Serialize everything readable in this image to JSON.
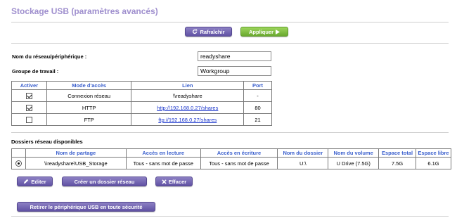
{
  "page": {
    "title": "Stockage USB (paramètres avancés)"
  },
  "toolbar": {
    "refresh_label": "Rafraîchir",
    "apply_label": "Appliquer"
  },
  "form": {
    "device_name_label": "Nom du réseau/périphérique :",
    "device_name_value": "readyshare",
    "workgroup_label": "Groupe de travail :",
    "workgroup_value": "Workgroup"
  },
  "access_table": {
    "headers": [
      "Activer",
      "Mode d'accès",
      "Lien",
      "Port"
    ],
    "rows": [
      {
        "enabled": true,
        "mode": "Connexion réseau",
        "link": "\\\\readyshare",
        "link_is_url": false,
        "port": "-"
      },
      {
        "enabled": true,
        "mode": "HTTP",
        "link": "http://192.168.0.27/shares",
        "link_is_url": true,
        "port": "80"
      },
      {
        "enabled": false,
        "mode": "FTP",
        "link": "ftp://192.168.0.27/shares",
        "link_is_url": true,
        "port": "21"
      }
    ]
  },
  "folders": {
    "title": "Dossiers réseau disponibles",
    "headers": [
      "",
      "Nom de partage",
      "Accès en lecture",
      "Accès en écriture",
      "Nom du dossier",
      "Nom du volume",
      "Espace total",
      "Espace libre"
    ],
    "rows": [
      {
        "selected": true,
        "share_name": "\\\\readyshare\\USB_Storage",
        "read_access": "Tous - sans mot de passe",
        "write_access": "Tous - sans mot de passe",
        "folder_name": "U:\\",
        "volume_name": "U Drive (7.5G)",
        "total_space": "7.5G",
        "free_space": "6.1G"
      }
    ]
  },
  "actions": {
    "edit_label": "Editer",
    "create_label": "Créer un dossier réseau",
    "delete_label": "Effacer"
  },
  "safe_remove": {
    "label": "Retirer le périphérique USB en toute sécurité"
  },
  "colors": {
    "title": "#9f8fce",
    "header_text": "#3a5fcd",
    "button_purple": "#6152a4",
    "button_green": "#6aa92f",
    "link": "#1a35cc"
  },
  "icons": {
    "refresh": "refresh-icon",
    "apply": "play-arrow-icon",
    "edit": "pencil-icon",
    "delete": "x-icon"
  }
}
